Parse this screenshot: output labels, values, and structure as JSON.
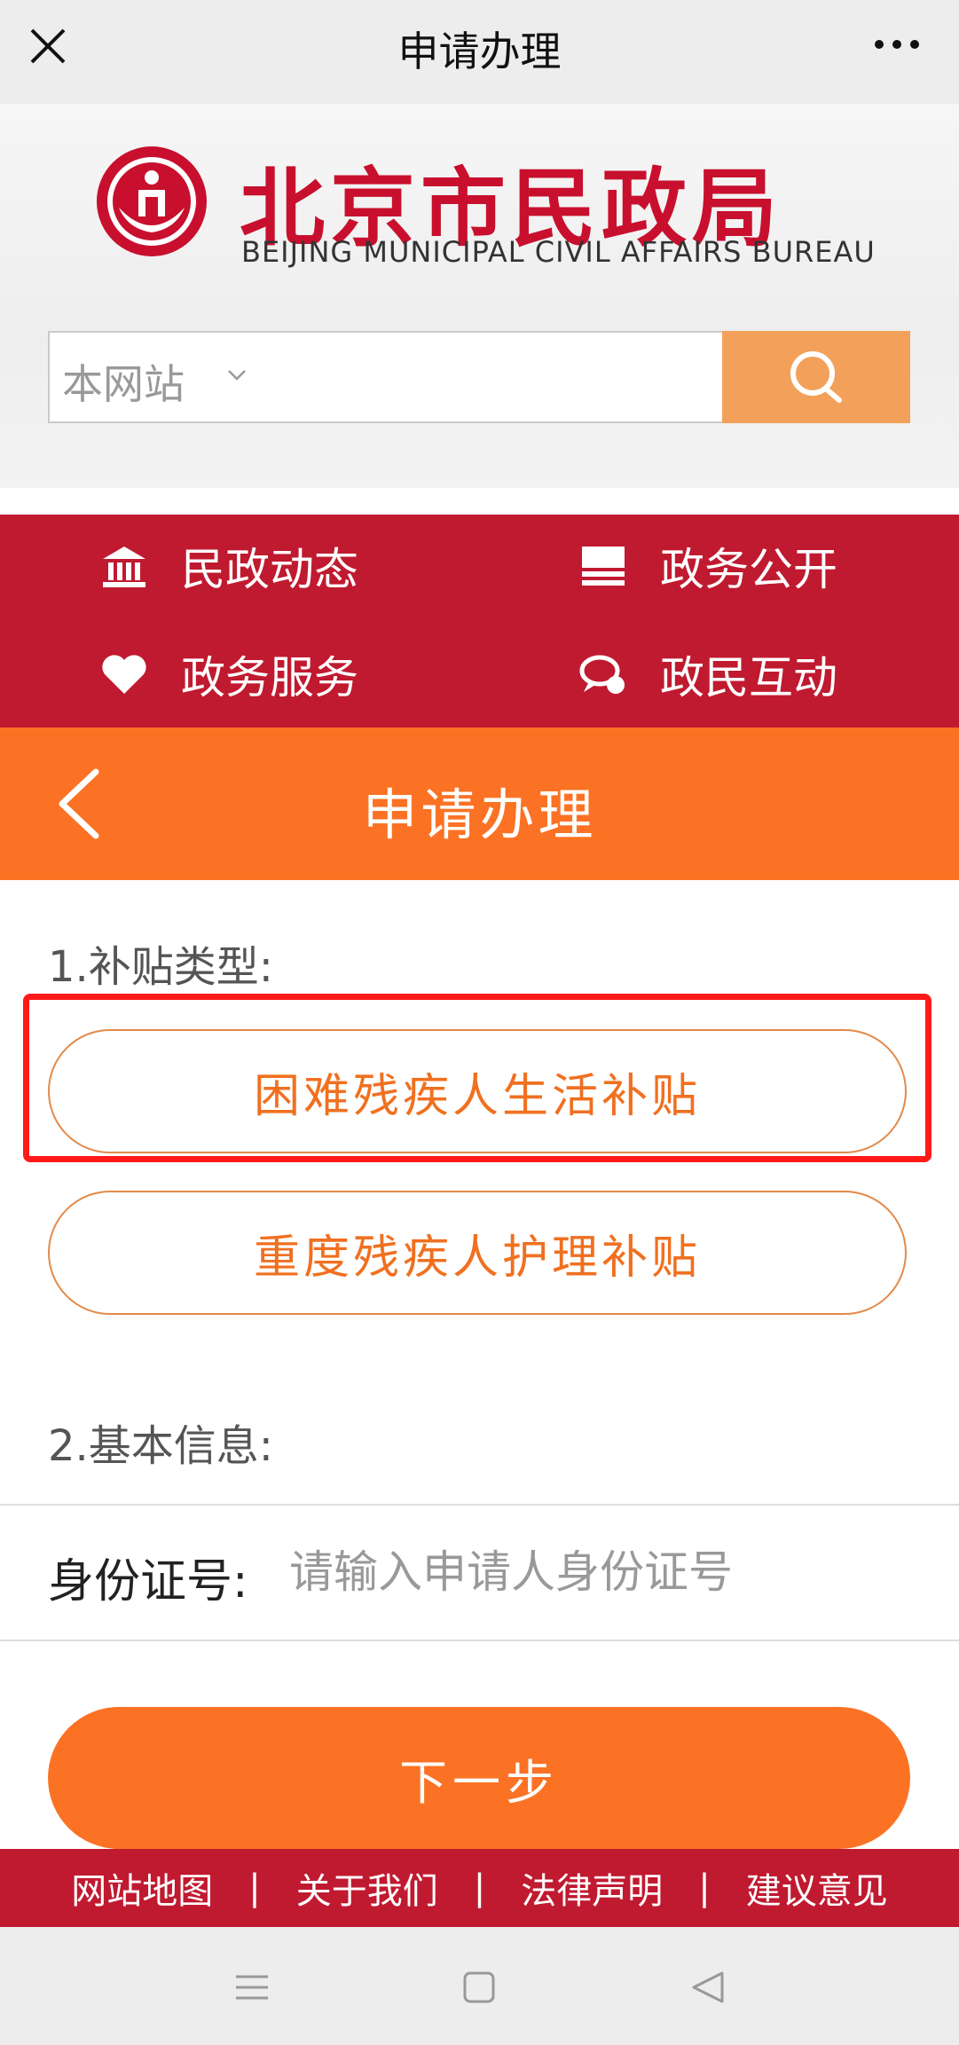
{
  "topbar": {
    "title": "申请办理",
    "close_icon": "close-icon",
    "more_icon": "more-icon"
  },
  "site": {
    "name_cn": "北京市民政局",
    "name_en": "BEIJING MUNICIPAL CIVIL AFFAIRS BUREAU",
    "brand_color": "#c8102e"
  },
  "search": {
    "scope_label": "本网站",
    "button_icon": "search-icon"
  },
  "nav": {
    "items": [
      {
        "label": "民政动态",
        "icon": "building-icon"
      },
      {
        "label": "政务公开",
        "icon": "stack-icon"
      },
      {
        "label": "政务服务",
        "icon": "heart-icon"
      },
      {
        "label": "政民互动",
        "icon": "chat-icon"
      }
    ],
    "background": "#c01a30"
  },
  "page": {
    "title": "申请办理",
    "accent": "#fb7224"
  },
  "form": {
    "section1": "1.补贴类型:",
    "options": [
      {
        "label": "困难残疾人生活补贴",
        "highlighted": true
      },
      {
        "label": "重度残疾人护理补贴",
        "highlighted": false
      }
    ],
    "section2": "2.基本信息:",
    "id_label": "身份证号:",
    "id_placeholder": "请输入申请人身份证号",
    "id_value": "",
    "next_label": "下一步"
  },
  "footer": {
    "links": [
      "网站地图",
      "关于我们",
      "法律声明",
      "建议意见"
    ],
    "separator": "|"
  },
  "system_nav": [
    "menu-icon",
    "home-square-icon",
    "back-triangle-icon"
  ]
}
